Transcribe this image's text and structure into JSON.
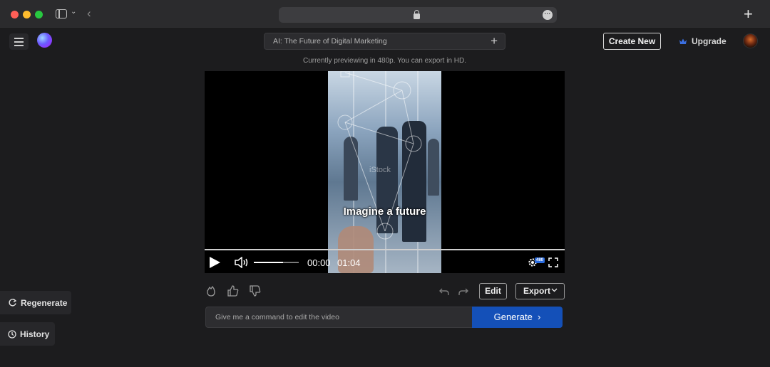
{
  "project": {
    "title": "AI: The Future of Digital Marketing"
  },
  "header": {
    "create_new_label": "Create New",
    "upgrade_label": "Upgrade"
  },
  "preview_note": "Currently previewing in 480p. You can export in HD.",
  "video": {
    "caption": "Imagine a future",
    "watermark": "iStock",
    "current_time": "00:00",
    "duration": "01:04",
    "quality_badge": "480",
    "volume_level": 0.65,
    "progress": 0.0
  },
  "actions": {
    "edit_label": "Edit",
    "export_label": "Export"
  },
  "command": {
    "placeholder": "Give me a command to edit the video",
    "generate_label": "Generate"
  },
  "sidebar": {
    "regenerate_label": "Regenerate",
    "history_label": "History"
  },
  "colors": {
    "accent": "#1450b8",
    "background": "#1c1c1e",
    "badge": "#2b6cdf"
  }
}
